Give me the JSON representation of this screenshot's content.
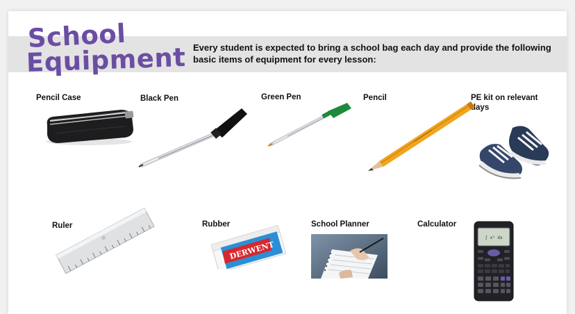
{
  "title": {
    "line1": "School",
    "line2": "Equipment"
  },
  "intro": "Every student is expected to bring a school bag each day and provide the following basic items of equipment for every lesson:",
  "items": [
    {
      "label": "Pencil Case",
      "icon": "pencil-case-icon"
    },
    {
      "label": "Black Pen",
      "icon": "black-pen-icon"
    },
    {
      "label": "Green Pen",
      "icon": "green-pen-icon"
    },
    {
      "label": "Pencil",
      "icon": "pencil-icon"
    },
    {
      "label": "PE kit on relevant days",
      "icon": "trainers-icon"
    },
    {
      "label": "Ruler",
      "icon": "ruler-icon"
    },
    {
      "label": "Rubber",
      "icon": "rubber-icon",
      "brand_text": "DERWENT"
    },
    {
      "label": "School Planner",
      "icon": "planner-icon"
    },
    {
      "label": "Calculator",
      "icon": "calculator-icon"
    }
  ],
  "colors": {
    "title": "#6b4ea3",
    "band": "#e3e3e3",
    "pen_green": "#1e8a3c",
    "pencil_yellow": "#f2a51c",
    "rubber_blue": "#2a8fd6",
    "rubber_red": "#d8262e"
  }
}
